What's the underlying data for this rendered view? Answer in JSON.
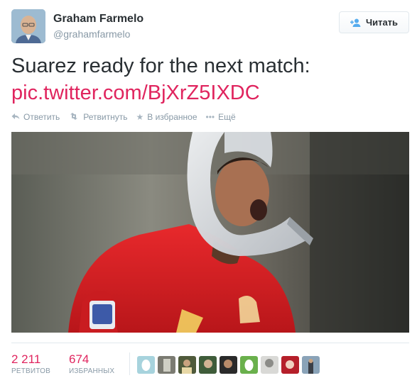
{
  "author": {
    "name": "Graham Farmelo",
    "handle": "@grahamfarmelo"
  },
  "follow_button": {
    "label": "Читать",
    "icon": "add-user-icon"
  },
  "tweet": {
    "text": "Suarez ready for the next match:",
    "link": "pic.twitter.com/BjXrZ5IXDC"
  },
  "actions": [
    {
      "label": "Ответить",
      "icon": "reply-icon"
    },
    {
      "label": "Ретвитнуть",
      "icon": "retweet-icon"
    },
    {
      "label": "В избранное",
      "icon": "star-icon"
    },
    {
      "label": "Ещё",
      "icon": "more-icon"
    }
  ],
  "stats": {
    "retweets": {
      "count": "2 211",
      "label": "РЕТВИТОВ"
    },
    "favorites": {
      "count": "674",
      "label": "ИЗБРАННЫХ"
    }
  },
  "colors": {
    "link": "#e0245e",
    "muted": "#8899a6",
    "text": "#292f33",
    "accent": "#55acee"
  },
  "photo": {
    "subject": "footballer in red shirt wearing a cone collar"
  }
}
